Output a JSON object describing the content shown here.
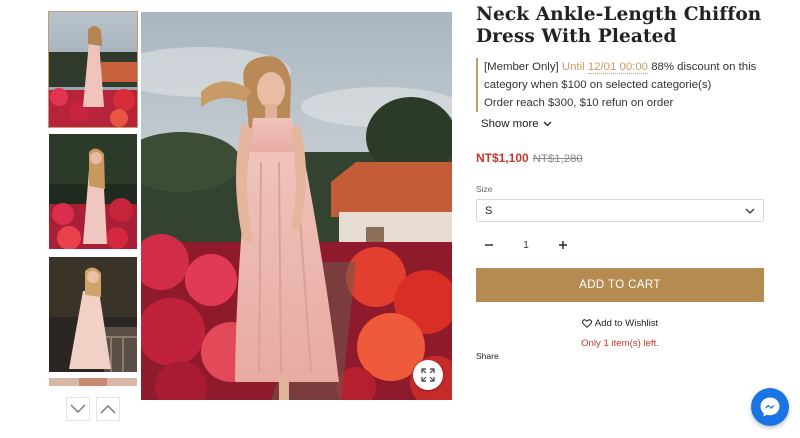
{
  "product": {
    "title": "Neck Ankle-Length Chiffon Dress With Pleated",
    "price": "NT$1,100",
    "original_price": "NT$1,280"
  },
  "promo": {
    "tag": "[Member Only]",
    "until_label": "Until",
    "until_date": "12/01 00:00",
    "line1_rest": "88% discount on this category when $100 on selected categorie(s)",
    "line2": "Order reach $300, $10 refun on order"
  },
  "show_more": {
    "label": "Show more",
    "icon": "chevron-down-icon"
  },
  "size": {
    "label": "Size",
    "selected": "S",
    "icon": "chevron-down-icon"
  },
  "quantity": {
    "value": "1",
    "minus_icon": "minus-icon",
    "plus_icon": "plus-icon"
  },
  "add_to_cart": {
    "label": "ADD TO CART",
    "color": "#b68b52"
  },
  "wishlist": {
    "label": "Add to Wishlist",
    "icon": "heart-icon"
  },
  "stock_note": "Only 1 item(s) left.",
  "share_label": "Share",
  "gallery": {
    "thumb_nav_down_icon": "chevron-down-icon",
    "thumb_nav_up_icon": "chevron-up-icon",
    "zoom_icon": "expand-icon"
  },
  "messenger": {
    "icon": "messenger-icon",
    "color": "#1b74e4"
  },
  "colors": {
    "accent": "#c69a6a",
    "sale_red": "#c0392b"
  }
}
